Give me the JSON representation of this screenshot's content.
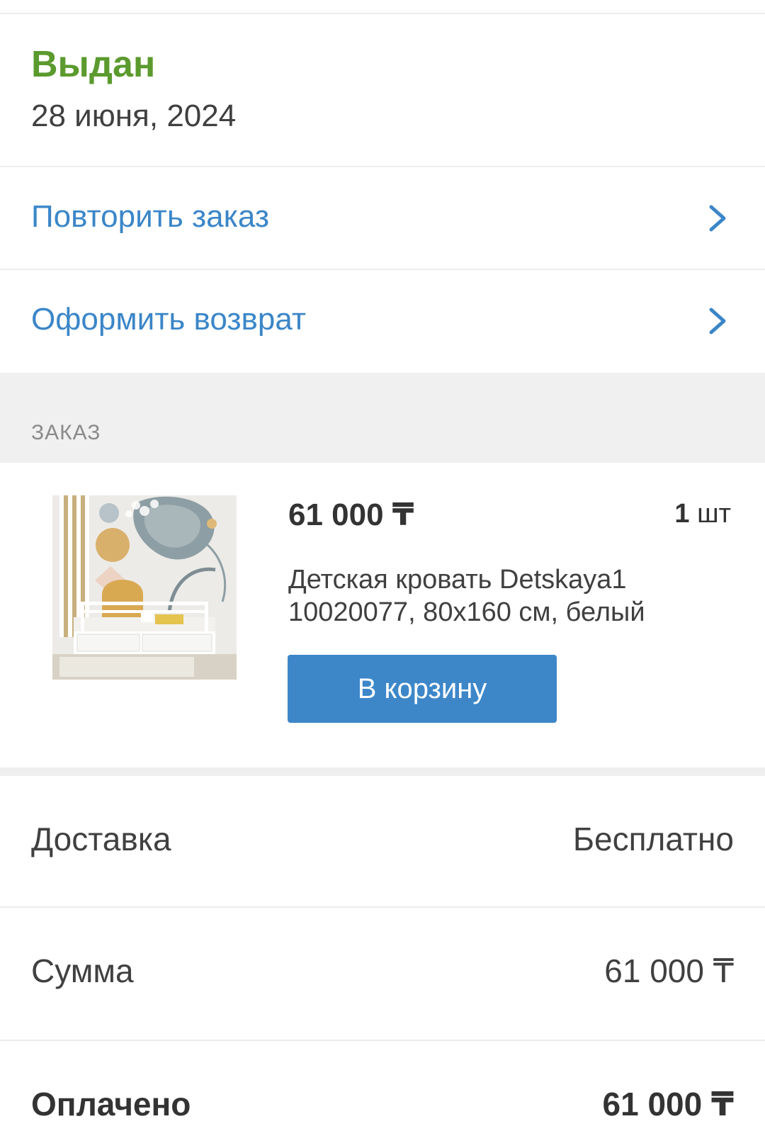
{
  "status": {
    "title": "Выдан",
    "date": "28 июня, 2024",
    "color": "#5b9a2e"
  },
  "actions": [
    {
      "label": "Повторить заказ",
      "icon": "chevron-right-icon"
    },
    {
      "label": "Оформить возврат",
      "icon": "chevron-right-icon"
    }
  ],
  "section": {
    "title": "ЗАКАЗ"
  },
  "product": {
    "price": "61 000 ₸",
    "qty_number": "1",
    "qty_unit": "шт",
    "name": "Детская кровать Detskaya1 10020077, 80x160 см, белый",
    "cart_button": "В корзину"
  },
  "summary": {
    "delivery_label": "Доставка",
    "delivery_value": "Бесплатно",
    "sum_label": "Сумма",
    "sum_value": "61 000 ₸",
    "paid_label": "Оплачено",
    "paid_value": "61 000 ₸"
  },
  "colors": {
    "accent": "#3b86c8",
    "button": "#3d87c9",
    "section_bg": "#f0f0f0"
  }
}
